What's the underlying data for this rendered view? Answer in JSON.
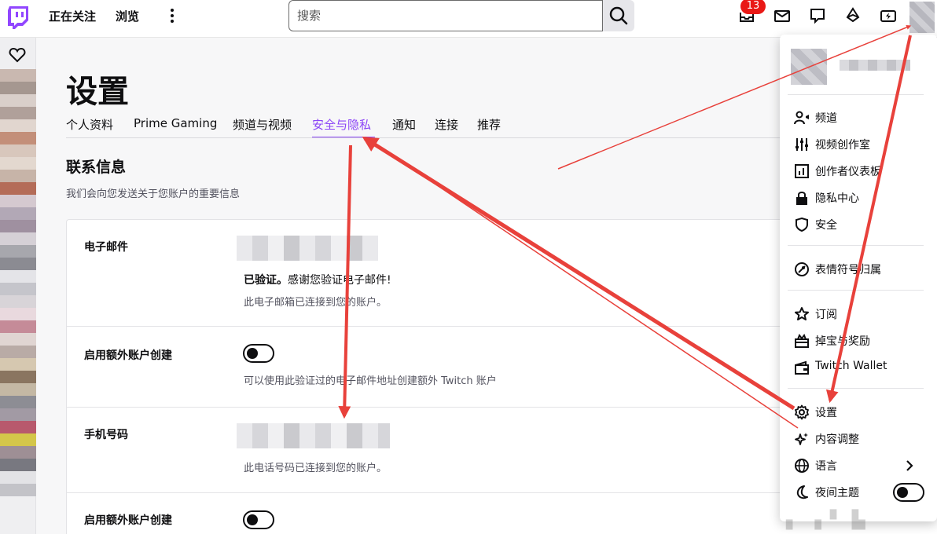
{
  "nav": {
    "following": "正在关注",
    "browse": "浏览",
    "notification_count": "13",
    "search_placeholder": "搜索"
  },
  "page": {
    "title": "设置",
    "tabs": [
      {
        "label": "个人资料"
      },
      {
        "label": "Prime Gaming"
      },
      {
        "label": "频道与视频"
      },
      {
        "label": "安全与隐私",
        "active": true
      },
      {
        "label": "通知"
      },
      {
        "label": "连接"
      },
      {
        "label": "推荐"
      }
    ]
  },
  "contact": {
    "title": "联系信息",
    "subtitle": "我们会向您发送关于您账户的重要信息",
    "email": {
      "label": "电子邮件",
      "verified_bold": "已验证。",
      "verified_text": "感谢您验证电子邮件!",
      "note": "此电子邮箱已连接到您的账户。"
    },
    "extra_accounts_1": {
      "label": "启用额外账户创建",
      "note": "可以使用此验证过的电子邮件地址创建额外 Twitch 账户",
      "enabled": false
    },
    "phone": {
      "label": "手机号码",
      "note": "此电话号码已连接到您的账户。"
    },
    "extra_accounts_2": {
      "label": "启用额外账户创建",
      "enabled": false
    }
  },
  "menu": {
    "items_group1": [
      {
        "label": "频道",
        "icon": "channel-icon"
      },
      {
        "label": "视频创作室",
        "icon": "sliders-icon"
      },
      {
        "label": "创作者仪表板",
        "icon": "dashboard-icon"
      },
      {
        "label": "隐私中心",
        "icon": "lock-icon"
      },
      {
        "label": "安全",
        "icon": "shield-icon"
      }
    ],
    "items_group2": [
      {
        "label": "表情符号归属",
        "icon": "emote-icon"
      }
    ],
    "items_group3": [
      {
        "label": "订阅",
        "icon": "star-icon"
      },
      {
        "label": "掉宝与奖励",
        "icon": "drops-icon"
      },
      {
        "label": "Twitch Wallet",
        "icon": "wallet-icon"
      }
    ],
    "items_group4": [
      {
        "label": "设置",
        "icon": "gear-icon"
      },
      {
        "label": "内容调整",
        "icon": "sparkle-icon"
      },
      {
        "label": "语言",
        "icon": "globe-icon"
      },
      {
        "label": "夜间主题",
        "icon": "moon-icon",
        "toggle": false
      }
    ]
  },
  "colors": {
    "accent": "#8c45f7",
    "badge": "#e91916",
    "annotation_arrow": "#e8413b"
  }
}
